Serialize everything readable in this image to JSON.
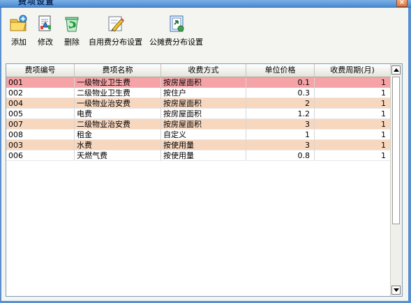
{
  "window": {
    "title": "费项设置",
    "close_label": "×"
  },
  "toolbar": [
    {
      "label": "添加",
      "icon": "folder-add-icon"
    },
    {
      "label": "修改",
      "icon": "edit-document-icon"
    },
    {
      "label": "删除",
      "icon": "recycle-delete-icon"
    },
    {
      "label": "自用费分布设置",
      "icon": "pencil-ruler-icon"
    },
    {
      "label": "公摊费分布设置",
      "icon": "share-export-icon"
    }
  ],
  "grid": {
    "columns": [
      "费项编号",
      "费项名称",
      "收费方式",
      "单位价格",
      "收费周期(月)"
    ],
    "rows": [
      {
        "code": "001",
        "name": "一级物业卫生费",
        "method": "按房屋面积",
        "price": "0.1",
        "period": "1"
      },
      {
        "code": "002",
        "name": "二级物业卫生费",
        "method": "按住户",
        "price": "0.3",
        "period": "1"
      },
      {
        "code": "004",
        "name": "一级物业治安费",
        "method": "按房屋面积",
        "price": "2",
        "period": "1"
      },
      {
        "code": "005",
        "name": "电费",
        "method": "按房屋面积",
        "price": "1.2",
        "period": "1"
      },
      {
        "code": "007",
        "name": "二级物业治安费",
        "method": "按房屋面积",
        "price": "3",
        "period": "1"
      },
      {
        "code": "008",
        "name": "租金",
        "method": "自定义",
        "price": "1",
        "period": "1"
      },
      {
        "code": "003",
        "name": "水费",
        "method": "按使用量",
        "price": "3",
        "period": "1"
      },
      {
        "code": "006",
        "name": "天燃气费",
        "method": "按使用量",
        "price": "0.8",
        "period": "1"
      }
    ],
    "selected_index": 0
  }
}
